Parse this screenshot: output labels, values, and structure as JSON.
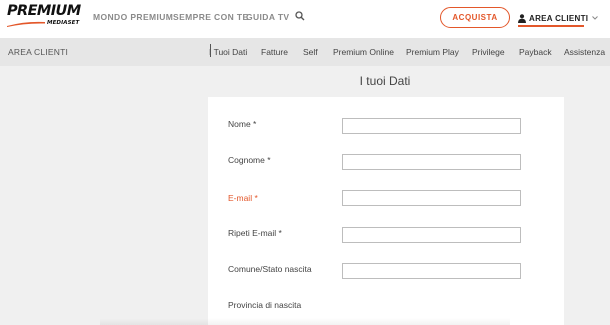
{
  "header": {
    "logo": {
      "main": "PREMIUM",
      "sub": "MEDIASET"
    },
    "nav": [
      {
        "label": "MONDO PREMIUM"
      },
      {
        "label": "SEMPRE CON TE"
      },
      {
        "label": "GUIDA TV"
      }
    ],
    "search_icon": "search-icon",
    "acquista_label": "ACQUISTA",
    "area_clienti_label": "AREA CLIENTI",
    "accent_color": "#e3572a"
  },
  "subnav": {
    "title": "AREA CLIENTI",
    "items": [
      {
        "label": "I Tuoi Dati"
      },
      {
        "label": "Fatture"
      },
      {
        "label": "Self"
      },
      {
        "label": "Premium Online"
      },
      {
        "label": "Premium Play"
      },
      {
        "label": "Privilege"
      },
      {
        "label": "Payback"
      },
      {
        "label": "Assistenza"
      }
    ]
  },
  "main": {
    "title": "I tuoi Dati",
    "fields": [
      {
        "label": "Nome *",
        "value": "",
        "state": "normal"
      },
      {
        "label": "Cognome *",
        "value": "",
        "state": "normal"
      },
      {
        "label": "E-mail *",
        "value": "",
        "state": "error"
      },
      {
        "label": "Ripeti E-mail *",
        "value": "",
        "state": "normal"
      },
      {
        "label": "Comune/Stato nascita",
        "value": "",
        "state": "normal"
      },
      {
        "label": "Provincia di nascita",
        "value": "",
        "state": "normal"
      }
    ]
  }
}
